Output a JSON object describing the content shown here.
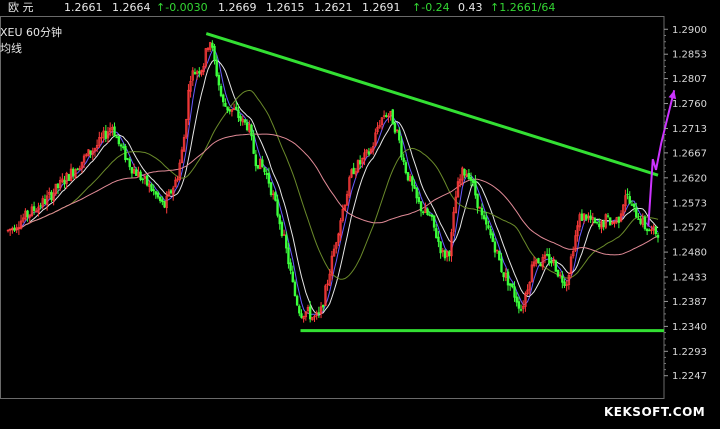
{
  "quote": {
    "symbol_cn": "欧  元",
    "last": "1.2661",
    "price2": "1.2664",
    "change": "-0.0030",
    "open": "1.2669",
    "low": "1.2615",
    "close": "1.2621",
    "high": "1.2691",
    "pct": "-0.24",
    "amp": "0.43",
    "last_ratio": "1.2661/64"
  },
  "legend": {
    "symbol_period": "XEU   60分钟",
    "ma_label": "均线"
  },
  "watermark": "KEKSOFT.COM",
  "colors": {
    "bull": "#ff3b3b",
    "bear": "#3cff3c",
    "trendline": "#33e033",
    "arrow": "#cc33ff",
    "ma_white": "#e6e6e6",
    "ma_blue": "#6a5cff",
    "ma_olive": "#6a8a2a",
    "ma_pink": "#e08a96"
  },
  "chart_data": {
    "type": "candlestick",
    "y_axis": {
      "ticks": [
        1.29,
        1.2853,
        1.2807,
        1.276,
        1.2713,
        1.2667,
        1.262,
        1.2573,
        1.2527,
        1.248,
        1.2433,
        1.2387,
        1.234,
        1.2293,
        1.2247
      ],
      "tick_labels": [
        "1.2900",
        "1.2853",
        "1.2807",
        "1.2760",
        "1.2713",
        "1.2667",
        "1.2620",
        "1.2573",
        "1.2527",
        "1.2480",
        "1.2433",
        "1.2387",
        "1.2340",
        "1.2293",
        "1.2247"
      ],
      "ylim": [
        1.2205,
        1.2925
      ]
    },
    "x": {
      "xlim": [
        0,
        100
      ]
    },
    "price_path": [
      [
        0,
        1.252
      ],
      [
        3,
        1.255
      ],
      [
        6,
        1.258
      ],
      [
        9,
        1.262
      ],
      [
        12,
        1.266
      ],
      [
        14,
        1.2685
      ],
      [
        16,
        1.272
      ],
      [
        17,
        1.2685
      ],
      [
        19,
        1.264
      ],
      [
        22,
        1.26
      ],
      [
        24,
        1.2565
      ],
      [
        26,
        1.262
      ],
      [
        27,
        1.2685
      ],
      [
        28,
        1.2812
      ],
      [
        29,
        1.2822
      ],
      [
        30,
        1.283
      ],
      [
        31,
        1.2885
      ],
      [
        32,
        1.2825
      ],
      [
        33,
        1.276
      ],
      [
        34,
        1.275
      ],
      [
        35,
        1.2745
      ],
      [
        36,
        1.2725
      ],
      [
        37,
        1.2718
      ],
      [
        38,
        1.2655
      ],
      [
        39,
        1.2642
      ],
      [
        40,
        1.262
      ],
      [
        41,
        1.2575
      ],
      [
        42,
        1.253
      ],
      [
        43,
        1.2472
      ],
      [
        44,
        1.2405
      ],
      [
        45,
        1.2365
      ],
      [
        46,
        1.2368
      ],
      [
        47,
        1.2355
      ],
      [
        48,
        1.236
      ],
      [
        49,
        1.2415
      ],
      [
        50,
        1.2475
      ],
      [
        51,
        1.2535
      ],
      [
        52,
        1.2585
      ],
      [
        53,
        1.2635
      ],
      [
        54,
        1.2645
      ],
      [
        55,
        1.266
      ],
      [
        56,
        1.2675
      ],
      [
        57,
        1.2722
      ],
      [
        58,
        1.2742
      ],
      [
        59,
        1.2735
      ],
      [
        60,
        1.27
      ],
      [
        61,
        1.2642
      ],
      [
        62,
        1.2608
      ],
      [
        63,
        1.2574
      ],
      [
        64,
        1.2555
      ],
      [
        65,
        1.2545
      ],
      [
        66,
        1.2508
      ],
      [
        67,
        1.2472
      ],
      [
        68,
        1.2485
      ],
      [
        69,
        1.2595
      ],
      [
        70,
        1.2632
      ],
      [
        71,
        1.2628
      ],
      [
        72,
        1.2585
      ],
      [
        73,
        1.254
      ],
      [
        74,
        1.2518
      ],
      [
        75,
        1.2488
      ],
      [
        76,
        1.2445
      ],
      [
        77,
        1.2425
      ],
      [
        78,
        1.2398
      ],
      [
        79,
        1.2372
      ],
      [
        80,
        1.242
      ],
      [
        81,
        1.2472
      ],
      [
        82,
        1.246
      ],
      [
        83,
        1.2468
      ],
      [
        84,
        1.246
      ],
      [
        85,
        1.2432
      ],
      [
        86,
        1.2425
      ],
      [
        87,
        1.2495
      ],
      [
        88,
        1.2546
      ],
      [
        89,
        1.2548
      ],
      [
        90,
        1.2535
      ],
      [
        91,
        1.2525
      ],
      [
        92,
        1.2542
      ],
      [
        93,
        1.2535
      ],
      [
        94,
        1.2545
      ],
      [
        95,
        1.2592
      ],
      [
        96,
        1.2562
      ],
      [
        97,
        1.2548
      ],
      [
        98,
        1.2528
      ],
      [
        99,
        1.2518
      ]
    ],
    "annotations": {
      "trendline": {
        "from": [
          30.5,
          1.2892
        ],
        "to": [
          100,
          1.2625
        ]
      },
      "support": {
        "from": [
          45,
          1.2332
        ],
        "to": [
          100,
          1.2332
        ]
      },
      "forecast_arrow": [
        [
          98.5,
          1.2528
        ],
        [
          99.2,
          1.2655
        ],
        [
          99.7,
          1.2635
        ],
        [
          100.5,
          1.2685
        ],
        [
          102.5,
          1.2785
        ]
      ]
    }
  }
}
